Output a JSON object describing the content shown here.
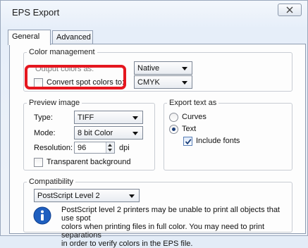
{
  "window": {
    "title": "EPS Export"
  },
  "tabs": [
    {
      "label": "General",
      "active": true
    },
    {
      "label": "Advanced",
      "active": false
    }
  ],
  "color_management": {
    "legend": "Color management",
    "output_colors_label": "Output colors as:",
    "output_colors_value": "Native",
    "convert_spot_label": "Convert spot colors to:",
    "convert_spot_checked": false,
    "convert_spot_value": "CMYK"
  },
  "preview_image": {
    "legend": "Preview image",
    "type_label": "Type:",
    "type_value": "TIFF",
    "mode_label": "Mode:",
    "mode_value": "8 bit Color",
    "resolution_label": "Resolution:",
    "resolution_value": "96",
    "resolution_unit": "dpi",
    "transparent_label": "Transparent background",
    "transparent_checked": false
  },
  "export_text": {
    "legend": "Export text as",
    "curves_label": "Curves",
    "text_label": "Text",
    "selected": "Text",
    "include_fonts_label": "Include fonts",
    "include_fonts_checked": true
  },
  "compatibility": {
    "legend": "Compatibility",
    "value": "PostScript Level 2",
    "info_line1": "PostScript level 2 printers may be unable to print all objects that use spot",
    "info_line2": "colors when printing files in full color. You may need to print separations",
    "info_line3": "in order to verify colors in the EPS file."
  },
  "colors": {
    "highlight": "#e5171f",
    "info_icon": "#1f5fbf",
    "tab_border": "#8e9bb0"
  }
}
